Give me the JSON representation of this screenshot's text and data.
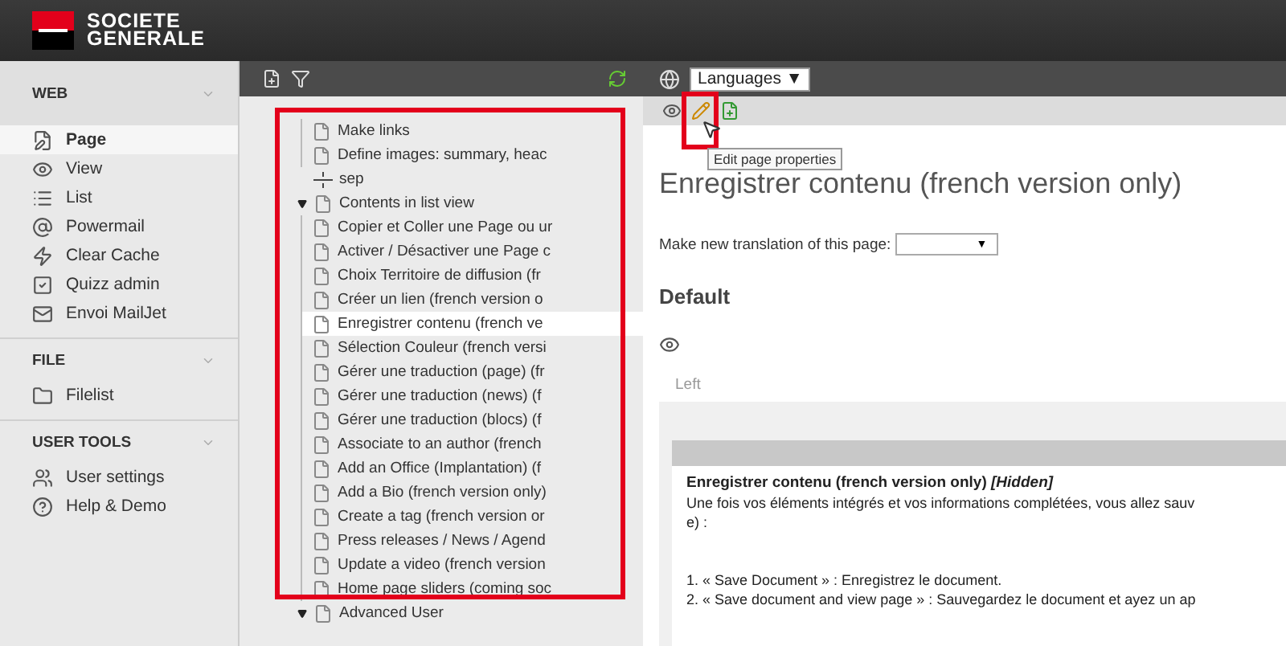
{
  "header": {
    "logo_lines": [
      "SOCIETE",
      "GENERALE"
    ]
  },
  "sidebar": {
    "sections": [
      {
        "title": "WEB",
        "items": [
          {
            "label": "Page",
            "selected": true
          },
          {
            "label": "View",
            "selected": false
          },
          {
            "label": "List",
            "selected": false
          },
          {
            "label": "Powermail",
            "selected": false
          },
          {
            "label": "Clear Cache",
            "selected": false
          },
          {
            "label": "Quizz admin",
            "selected": false
          },
          {
            "label": "Envoi MailJet",
            "selected": false
          }
        ]
      },
      {
        "title": "FILE",
        "items": [
          {
            "label": "Filelist",
            "selected": false
          }
        ]
      },
      {
        "title": "USER TOOLS",
        "items": [
          {
            "label": "User settings",
            "selected": false
          },
          {
            "label": "Help & Demo",
            "selected": false
          }
        ]
      }
    ]
  },
  "tree": {
    "items": [
      {
        "kind": "continuation",
        "children": [
          {
            "kind": "page",
            "label": "Make links",
            "selected": false
          },
          {
            "kind": "page",
            "label": "Define images: summary, heac",
            "selected": false
          }
        ]
      },
      {
        "kind": "separator",
        "label": "sep",
        "selected": false
      },
      {
        "kind": "page",
        "label": "Contents in list view",
        "expanded": true,
        "selected": false,
        "children": [
          {
            "kind": "page",
            "label": "Copier et Coller une Page ou ur",
            "selected": false
          },
          {
            "kind": "page",
            "label": "Activer / Désactiver une Page c",
            "selected": false
          },
          {
            "kind": "page",
            "label": "Choix Territoire de diffusion (fr",
            "selected": false
          },
          {
            "kind": "page",
            "label": "Créer un lien (french version o",
            "selected": false
          },
          {
            "kind": "page",
            "label": "Enregistrer contenu (french ve",
            "selected": true
          },
          {
            "kind": "page",
            "label": "Sélection Couleur (french versi",
            "selected": false
          },
          {
            "kind": "page",
            "label": "Gérer une traduction (page) (fr",
            "selected": false
          },
          {
            "kind": "page",
            "label": "Gérer une traduction (news) (f",
            "selected": false
          },
          {
            "kind": "page",
            "label": "Gérer une traduction (blocs) (f",
            "selected": false
          },
          {
            "kind": "page",
            "label": "Associate to an author (french",
            "selected": false
          },
          {
            "kind": "page",
            "label": "Add an Office (Implantation) (f",
            "selected": false
          },
          {
            "kind": "page",
            "label": "Add a Bio (french version only)",
            "selected": false
          },
          {
            "kind": "page",
            "label": "Create a tag (french version or",
            "selected": false
          },
          {
            "kind": "page",
            "label": "Press releases / News / Agend",
            "selected": false
          },
          {
            "kind": "page",
            "label": "Update a video (french version",
            "selected": false
          },
          {
            "kind": "page",
            "label": "Home page sliders (coming soc",
            "selected": false
          }
        ]
      },
      {
        "kind": "page",
        "label": "Advanced User",
        "expanded": true,
        "selected": false
      }
    ]
  },
  "page": {
    "languages_select": "Languages ▼",
    "tooltip": "Edit page properties",
    "title": "Enregistrer contenu (french version only)",
    "translation_label": "Make new translation of this page:",
    "translation_select": "▼",
    "section_title": "Default",
    "column_label": "Left",
    "content": {
      "title": "Enregistrer contenu (french version only) *[Hidden]*",
      "paragraph_lines": [
        "Une fois vos éléments intégrés et vos informations complétées, vous allez sauv",
        "e) :"
      ],
      "list": [
        "1. « Save Document »  : Enregistrez le document.",
        "2. « Save document and view page »  : Sauvegardez le document et ayez un ap"
      ]
    }
  }
}
